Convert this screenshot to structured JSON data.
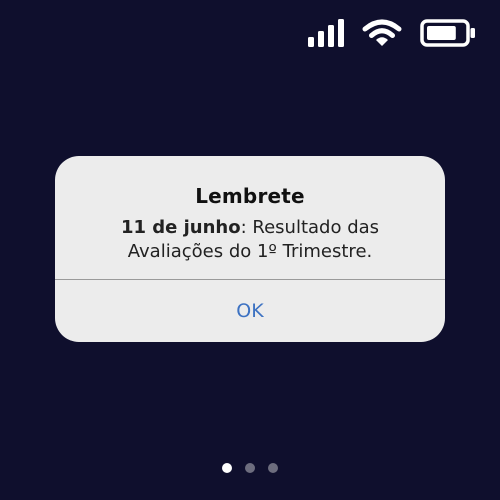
{
  "status_bar": {
    "signal_icon": "signal-bars-icon",
    "wifi_icon": "wifi-icon",
    "battery_icon": "battery-icon",
    "battery_level": 0.8
  },
  "alert": {
    "title": "Lembrete",
    "message_date": "11 de junho",
    "message_text": ": Resultado das Avaliações do 1º Trimestre.",
    "button_label": "OK"
  },
  "page_indicator": {
    "total_pages": 3,
    "current_page": 1
  },
  "colors": {
    "background": "#0f0f2d",
    "alert_background": "#ececec",
    "button_text": "#3d72c2",
    "dot_active": "#ffffff",
    "dot_inactive": "#6d6d7e"
  }
}
